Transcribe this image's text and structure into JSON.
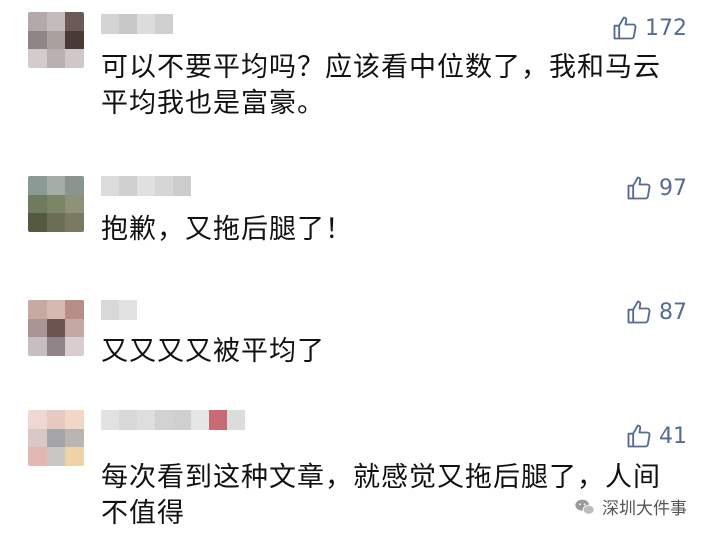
{
  "comments": [
    {
      "likes": "172",
      "text": "可以不要平均吗？应该看中位数了，我和马云\n平均我也是富豪。",
      "avatar_colors": [
        "#b3a9a8",
        "#c2bcbc",
        "#6b5a57",
        "#8f8584",
        "#a99f9d",
        "#4a3a35",
        "#d2cccb",
        "#b9b1b0",
        "#cfc8c6"
      ],
      "name_colors": [
        "#d4d4d4",
        "#c8c8c8",
        "#dcdcdc",
        "#cfcfcf"
      ]
    },
    {
      "likes": "97",
      "text": "抱歉，又拖后腿了！",
      "avatar_colors": [
        "#8a9a94",
        "#a3aea9",
        "#8b958f",
        "#6f7a5f",
        "#7c8466",
        "#8e9277",
        "#55593f",
        "#6b6d55",
        "#7a7a62"
      ],
      "name_colors": [
        "#dcdcdc",
        "#d0d0d0",
        "#e0e0e0",
        "#d6d6d6",
        "#cccccc"
      ]
    },
    {
      "likes": "87",
      "text": "又又又又被平均了",
      "avatar_colors": [
        "#c8a9a2",
        "#d7b9b2",
        "#b78d85",
        "#a99591",
        "#6c5550",
        "#c3a8a4",
        "#c6bec1",
        "#8f8387",
        "#d8cdcf"
      ],
      "name_colors": [
        "#d8d8d8",
        "#e2e2e2"
      ]
    },
    {
      "likes": "41",
      "text": "每次看到这种文章，就感觉又拖后腿了，人间\n不值得",
      "avatar_colors": [
        "#f0d8d2",
        "#e8c9c2",
        "#f2d6c6",
        "#d9c8c4",
        "#a3a6a8",
        "#b8b5b2",
        "#e2b7b3",
        "#c9c7c6",
        "#efd3a7"
      ],
      "name_colors": [
        "#e2e2e2",
        "#d8d8d8",
        "#dedede",
        "#d2d2d2",
        "#cfcfcf",
        "#e6e6e6",
        "#c86a73",
        "#dcdcdc"
      ]
    }
  ],
  "watermark": {
    "label": "深圳大件事",
    "icon": "wechat-icon"
  },
  "accent_color": "#576b95"
}
